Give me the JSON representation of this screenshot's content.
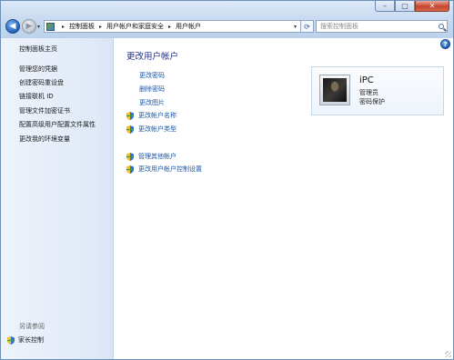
{
  "window": {
    "minimize": "–",
    "maximize": "□",
    "close": "✕"
  },
  "nav": {
    "back": "◀",
    "forward": "▶"
  },
  "address": {
    "crumbs": [
      "控制面板",
      "用户帐户和家庭安全",
      "用户帐户"
    ],
    "separator": "▸",
    "refresh": "⟳"
  },
  "search": {
    "placeholder": "搜索控制面板"
  },
  "sidebar": {
    "home": "控制面板主页",
    "items": [
      "管理您的凭据",
      "创建密码重设盘",
      "链接联机 ID",
      "管理文件加密证书",
      "配置高级用户配置文件属性",
      "更改我的环境变量"
    ],
    "see_also": "另请参阅",
    "see_also_items": [
      "家长控制"
    ]
  },
  "main": {
    "help": "?",
    "title": "更改用户帐户",
    "links": [
      "更改密码",
      "删除密码",
      "更改图片"
    ],
    "shield_links": [
      "更改帐户名称",
      "更改帐户类型"
    ],
    "other_links": [
      "管理其他帐户",
      "更改用户帐户控制设置"
    ]
  },
  "user": {
    "name": "iPC",
    "role": "管理员",
    "status": "密码保护"
  },
  "colors": {
    "link": "#1a57a8",
    "title": "#1e3287"
  }
}
